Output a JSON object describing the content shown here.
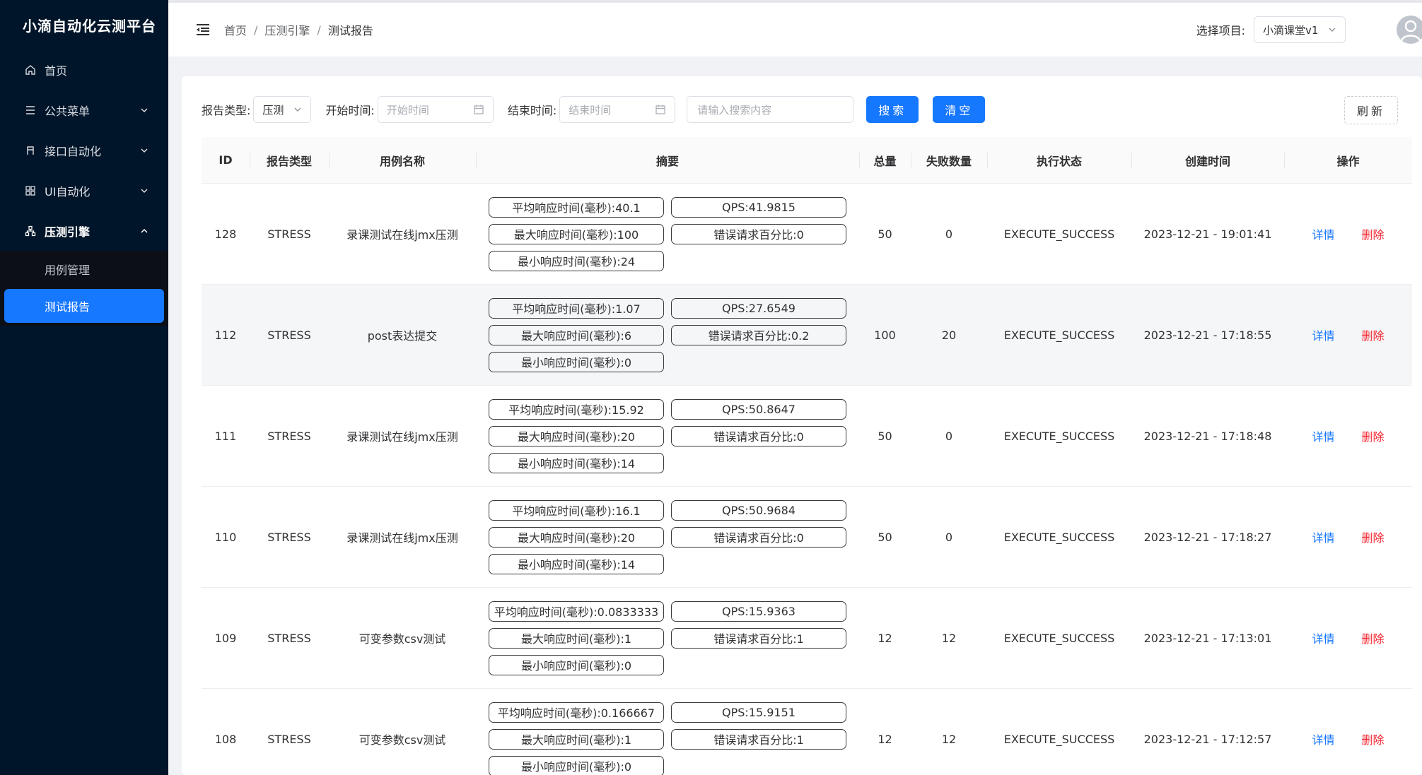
{
  "app": {
    "title": "小滴自动化云测平台"
  },
  "sidebar": {
    "items": [
      {
        "label": "首页",
        "icon": "home-icon"
      },
      {
        "label": "公共菜单",
        "icon": "menu-list-icon"
      },
      {
        "label": "接口自动化",
        "icon": "api-icon"
      },
      {
        "label": "UI自动化",
        "icon": "grid-icon"
      },
      {
        "label": "压测引擎",
        "icon": "sitemap-icon"
      }
    ],
    "sub_items": [
      {
        "label": "用例管理"
      },
      {
        "label": "测试报告"
      }
    ]
  },
  "header": {
    "breadcrumb": [
      "首页",
      "压测引擎",
      "测试报告"
    ],
    "separator": "/",
    "project_label": "选择项目:",
    "project_value": "小滴课堂v1"
  },
  "filter": {
    "report_type_label": "报告类型:",
    "report_type_value": "压测",
    "start_label": "开始时间:",
    "start_placeholder": "开始时间",
    "end_label": "结束时间:",
    "end_placeholder": "结束时间",
    "search_placeholder": "请输入搜索内容",
    "search_button": "搜索",
    "clear_button": "清空",
    "refresh_button": "刷新"
  },
  "table": {
    "columns": [
      "ID",
      "报告类型",
      "用例名称",
      "摘要",
      "总量",
      "失败数量",
      "执行状态",
      "创建时间",
      "操作"
    ],
    "rows": [
      {
        "id": "128",
        "type": "STRESS",
        "name": "录课测试在线jmx压测",
        "avg": "平均响应时间(毫秒):40.1",
        "qps": "QPS:41.9815",
        "max": "最大响应时间(毫秒):100",
        "err": "错误请求百分比:0",
        "min": "最小响应时间(毫秒):24",
        "total": "50",
        "fail": "0",
        "status": "EXECUTE_SUCCESS",
        "time": "2023-12-21 - 19:01:41",
        "detail": "详情",
        "del": "删除"
      },
      {
        "id": "112",
        "type": "STRESS",
        "name": "post表达提交",
        "avg": "平均响应时间(毫秒):1.07",
        "qps": "QPS:27.6549",
        "max": "最大响应时间(毫秒):6",
        "err": "错误请求百分比:0.2",
        "min": "最小响应时间(毫秒):0",
        "total": "100",
        "fail": "20",
        "status": "EXECUTE_SUCCESS",
        "time": "2023-12-21 - 17:18:55",
        "detail": "详情",
        "del": "删除"
      },
      {
        "id": "111",
        "type": "STRESS",
        "name": "录课测试在线jmx压测",
        "avg": "平均响应时间(毫秒):15.92",
        "qps": "QPS:50.8647",
        "max": "最大响应时间(毫秒):20",
        "err": "错误请求百分比:0",
        "min": "最小响应时间(毫秒):14",
        "total": "50",
        "fail": "0",
        "status": "EXECUTE_SUCCESS",
        "time": "2023-12-21 - 17:18:48",
        "detail": "详情",
        "del": "删除"
      },
      {
        "id": "110",
        "type": "STRESS",
        "name": "录课测试在线jmx压测",
        "avg": "平均响应时间(毫秒):16.1",
        "qps": "QPS:50.9684",
        "max": "最大响应时间(毫秒):20",
        "err": "错误请求百分比:0",
        "min": "最小响应时间(毫秒):14",
        "total": "50",
        "fail": "0",
        "status": "EXECUTE_SUCCESS",
        "time": "2023-12-21 - 17:18:27",
        "detail": "详情",
        "del": "删除"
      },
      {
        "id": "109",
        "type": "STRESS",
        "name": "可变参数csv测试",
        "avg": "平均响应时间(毫秒):0.0833333",
        "qps": "QPS:15.9363",
        "max": "最大响应时间(毫秒):1",
        "err": "错误请求百分比:1",
        "min": "最小响应时间(毫秒):0",
        "total": "12",
        "fail": "12",
        "status": "EXECUTE_SUCCESS",
        "time": "2023-12-21 - 17:13:01",
        "detail": "详情",
        "del": "删除"
      },
      {
        "id": "108",
        "type": "STRESS",
        "name": "可变参数csv测试",
        "avg": "平均响应时间(毫秒):0.166667",
        "qps": "QPS:15.9151",
        "max": "最大响应时间(毫秒):1",
        "err": "错误请求百分比:1",
        "min": "最小响应时间(毫秒):0",
        "total": "12",
        "fail": "12",
        "status": "EXECUTE_SUCCESS",
        "time": "2023-12-21 - 17:12:57",
        "detail": "详情",
        "del": "删除"
      }
    ]
  },
  "colors": {
    "sidebar_bg": "#001529",
    "primary": "#1677ff",
    "danger": "#f5222d"
  }
}
